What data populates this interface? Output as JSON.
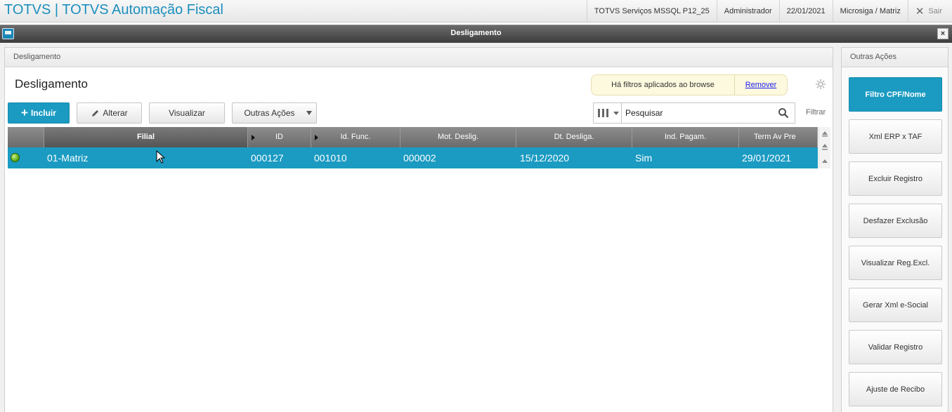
{
  "topbar": {
    "app_title": "TOTVS | TOTVS Automação Fiscal",
    "server": "TOTVS Serviços MSSQL P12_25",
    "user": "Administrador",
    "date": "22/01/2021",
    "company": "Microsiga / Matriz",
    "exit_label": "Sair"
  },
  "window": {
    "title": "Desligamento",
    "close_glyph": "×"
  },
  "main": {
    "panel_header": "Desligamento",
    "page_title": "Desligamento",
    "filter_message": "Há filtros aplicados ao browse",
    "filter_remove": "Remover",
    "buttons": {
      "incluir": "Incluir",
      "alterar": "Alterar",
      "visualizar": "Visualizar",
      "outras_acoes": "Outras Ações"
    },
    "search": {
      "placeholder": "Pesquisar"
    },
    "filtrar_label": "Filtrar",
    "grid": {
      "columns": [
        "Filial",
        "ID",
        "Id. Func.",
        "Mot. Deslig.",
        "Dt. Desliga.",
        "Ind. Pagam.",
        "Term Av Pre"
      ],
      "rows": [
        {
          "status": "green",
          "filial": "01-Matriz",
          "id": "000127",
          "id_func": "001010",
          "mot_deslig": "000002",
          "dt_desliga": "15/12/2020",
          "ind_pagam": "Sim",
          "term_av_pre": "29/01/2021"
        }
      ]
    }
  },
  "side": {
    "header": "Outras Ações",
    "buttons": [
      "Filtro CPF/Nome",
      "Xml ERP x TAF",
      "Excluir Registro",
      "Desfazer Exclusão",
      "Visualizar Reg.Excl.",
      "Gerar Xml e-Social",
      "Validar Registro",
      "Ajuste de Recibo"
    ]
  },
  "colors": {
    "accent": "#1b9bc2",
    "title_blue": "#1c8fbd",
    "status_ok": "#5fae18"
  }
}
